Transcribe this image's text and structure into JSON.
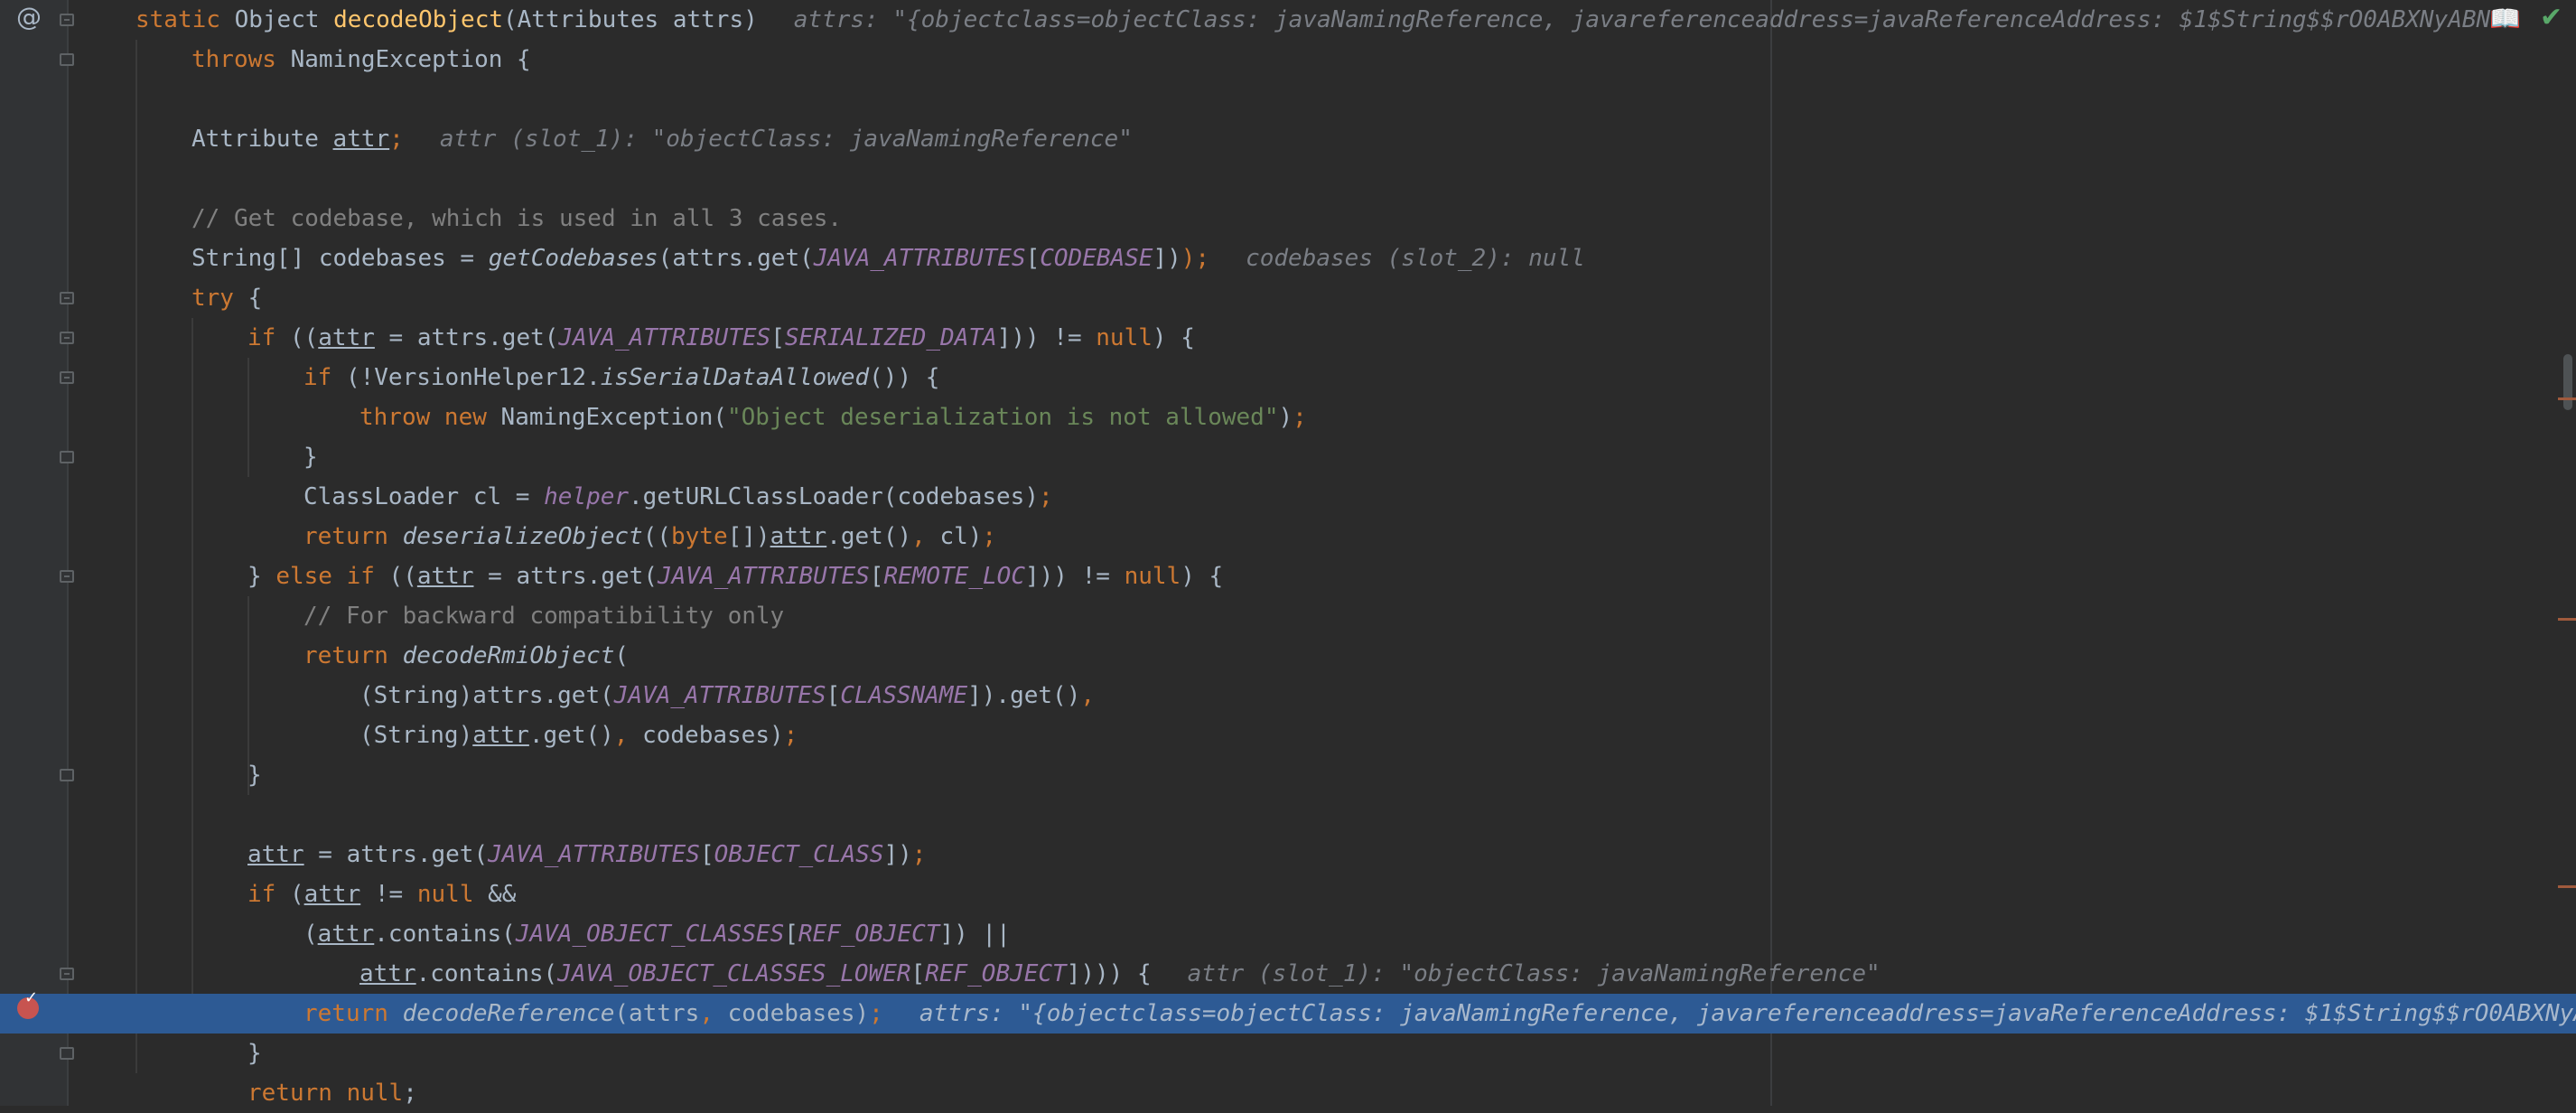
{
  "editor": {
    "lines": [
      {
        "segs": [
          [
            "kw",
            "static "
          ],
          [
            "",
            "Object "
          ],
          [
            "fn",
            "decodeObject"
          ],
          [
            "",
            "(Attributes attrs)"
          ]
        ],
        "hint": "attrs: \"{objectclass=objectClass: javaNamingReference, javareferenceaddress=javaReferenceAddress: $1$String$$rO0ABXNyABN"
      },
      {
        "segs": [
          [
            "kw",
            "throws "
          ],
          [
            "",
            "NamingException {"
          ]
        ]
      },
      {
        "segs": []
      },
      {
        "segs": [
          [
            "",
            "Attribute "
          ],
          [
            "ul",
            "attr"
          ],
          [
            "kw",
            ";"
          ]
        ],
        "hint": "attr (slot_1): \"objectClass: javaNamingReference\""
      },
      {
        "segs": []
      },
      {
        "segs": [
          [
            "cmt",
            "// Get codebase, which is used in all 3 cases."
          ]
        ]
      },
      {
        "segs": [
          [
            "",
            "String[] codebases = "
          ],
          [
            "it",
            "getCodebases"
          ],
          [
            "",
            "(attrs.get("
          ],
          [
            "cst",
            "JAVA_ATTRIBUTES"
          ],
          [
            "",
            "["
          ],
          [
            "cst",
            "CODEBASE"
          ],
          [
            "",
            "])"
          ],
          [
            "kw",
            ");"
          ]
        ],
        "hint": "codebases (slot_2): null"
      },
      {
        "segs": [
          [
            "kw",
            "try "
          ],
          [
            "",
            "{"
          ]
        ]
      },
      {
        "segs": [
          [
            "kw",
            "if "
          ],
          [
            "",
            "(("
          ],
          [
            "ul",
            "attr"
          ],
          [
            "",
            " = attrs.get("
          ],
          [
            "cst",
            "JAVA_ATTRIBUTES"
          ],
          [
            "",
            "["
          ],
          [
            "cst",
            "SERIALIZED_DATA"
          ],
          [
            "",
            "])) != "
          ],
          [
            "kw",
            "null"
          ],
          [
            "",
            ") {"
          ]
        ]
      },
      {
        "segs": [
          [
            "kw",
            "if "
          ],
          [
            "",
            "(!VersionHelper12."
          ],
          [
            "it",
            "isSerialDataAllowed"
          ],
          [
            "",
            "()) {"
          ]
        ]
      },
      {
        "segs": [
          [
            "kw",
            "throw new "
          ],
          [
            "",
            "NamingException("
          ],
          [
            "str",
            "\"Object deserialization is not allowed\""
          ],
          [
            "",
            ")"
          ],
          [
            "kw",
            ";"
          ]
        ]
      },
      {
        "segs": [
          [
            "",
            "}"
          ]
        ]
      },
      {
        "segs": [
          [
            "",
            "ClassLoader cl = "
          ],
          [
            "cst",
            "helper"
          ],
          [
            "",
            ".getURLClassLoader(codebases)"
          ],
          [
            "kw",
            ";"
          ]
        ]
      },
      {
        "segs": [
          [
            "kw",
            "return "
          ],
          [
            "it",
            "deserializeObject"
          ],
          [
            "",
            "(("
          ],
          [
            "kw",
            "byte"
          ],
          [
            "",
            "[])"
          ],
          [
            "ul",
            "attr"
          ],
          [
            "",
            ".get()"
          ],
          [
            "kw",
            ", "
          ],
          [
            "",
            "cl)"
          ],
          [
            "kw",
            ";"
          ]
        ]
      },
      {
        "segs": [
          [
            "",
            "} "
          ],
          [
            "kw",
            "else if "
          ],
          [
            "",
            "(("
          ],
          [
            "ul",
            "attr"
          ],
          [
            "",
            " = attrs.get("
          ],
          [
            "cst",
            "JAVA_ATTRIBUTES"
          ],
          [
            "",
            "["
          ],
          [
            "cst",
            "REMOTE_LOC"
          ],
          [
            "",
            "])) != "
          ],
          [
            "kw",
            "null"
          ],
          [
            "",
            ") {"
          ]
        ]
      },
      {
        "segs": [
          [
            "cmt",
            "// For backward compatibility only"
          ]
        ]
      },
      {
        "segs": [
          [
            "kw",
            "return "
          ],
          [
            "it",
            "decodeRmiObject"
          ],
          [
            "",
            "("
          ]
        ]
      },
      {
        "segs": [
          [
            "",
            "(String)attrs.get("
          ],
          [
            "cst",
            "JAVA_ATTRIBUTES"
          ],
          [
            "",
            "["
          ],
          [
            "cst",
            "CLASSNAME"
          ],
          [
            "",
            "]).get()"
          ],
          [
            "kw",
            ","
          ]
        ]
      },
      {
        "segs": [
          [
            "",
            "(String)"
          ],
          [
            "ul",
            "attr"
          ],
          [
            "",
            ".get()"
          ],
          [
            "kw",
            ", "
          ],
          [
            "",
            "codebases)"
          ],
          [
            "kw",
            ";"
          ]
        ]
      },
      {
        "segs": [
          [
            "",
            "}"
          ]
        ]
      },
      {
        "segs": []
      },
      {
        "segs": [
          [
            "ul",
            "attr"
          ],
          [
            "",
            " = attrs.get("
          ],
          [
            "cst",
            "JAVA_ATTRIBUTES"
          ],
          [
            "",
            "["
          ],
          [
            "cst",
            "OBJECT_CLASS"
          ],
          [
            "",
            "])"
          ],
          [
            "kw",
            ";"
          ]
        ]
      },
      {
        "segs": [
          [
            "kw",
            "if "
          ],
          [
            "",
            "("
          ],
          [
            "ul",
            "attr"
          ],
          [
            "",
            " != "
          ],
          [
            "kw",
            "null "
          ],
          [
            "",
            "&&"
          ]
        ]
      },
      {
        "segs": [
          [
            "",
            "("
          ],
          [
            "ul",
            "attr"
          ],
          [
            "",
            ".contains("
          ],
          [
            "cst",
            "JAVA_OBJECT_CLASSES"
          ],
          [
            "",
            "["
          ],
          [
            "cst",
            "REF_OBJECT"
          ],
          [
            "",
            "]) ||"
          ]
        ]
      },
      {
        "segs": [
          [
            "ul",
            "attr"
          ],
          [
            "",
            ".contains("
          ],
          [
            "cst",
            "JAVA_OBJECT_CLASSES_LOWER"
          ],
          [
            "",
            "["
          ],
          [
            "cst",
            "REF_OBJECT"
          ],
          [
            "",
            "]))) {"
          ]
        ],
        "hint": "attr (slot_1): \"objectClass: javaNamingReference\""
      },
      {
        "segs": [
          [
            "kw",
            "return "
          ],
          [
            "it",
            "decodeReference"
          ],
          [
            "",
            "(attrs"
          ],
          [
            "kw",
            ", "
          ],
          [
            "",
            "codebases)"
          ],
          [
            "kw",
            ";"
          ]
        ],
        "hint": "attrs: \"{objectclass=objectClass: javaNamingReference, javareferenceaddress=javaReferenceAddress: $1$String$$rO0ABXNyA"
      },
      {
        "segs": [
          [
            "",
            "}"
          ]
        ]
      },
      {
        "segs": [
          [
            "kw",
            "return null"
          ],
          [
            "",
            ";"
          ]
        ]
      }
    ]
  },
  "gutter": {
    "annotation_icon": "@",
    "breakpoint_icon": "breakpoint-check-icon"
  },
  "status": {
    "reader_mode_icon": "📖",
    "inspection_ok_icon": "✔"
  }
}
